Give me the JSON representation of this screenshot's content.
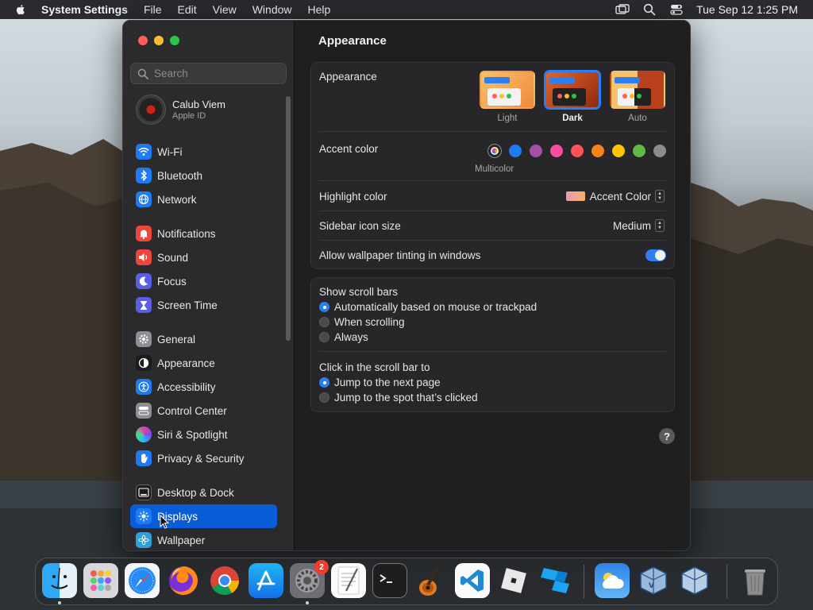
{
  "menubar": {
    "app_name": "System Settings",
    "menus": [
      "File",
      "Edit",
      "View",
      "Window",
      "Help"
    ],
    "clock": "Tue Sep 12  1:25 PM"
  },
  "sidebar": {
    "search_placeholder": "Search",
    "account": {
      "name": "Calub Viem",
      "subtitle": "Apple ID"
    },
    "items": [
      {
        "label": "Wi-Fi",
        "icon": "wifi-icon",
        "color": "#1e7bf2"
      },
      {
        "label": "Bluetooth",
        "icon": "bluetooth-icon",
        "color": "#1e7bf2"
      },
      {
        "label": "Network",
        "icon": "globe-icon",
        "color": "#1e7bf2"
      },
      {
        "label": "Notifications",
        "icon": "bell-icon",
        "color": "#f0453a"
      },
      {
        "label": "Sound",
        "icon": "speaker-icon",
        "color": "#f0453a"
      },
      {
        "label": "Focus",
        "icon": "moon-icon",
        "color": "#5b5ee0"
      },
      {
        "label": "Screen Time",
        "icon": "hourglass-icon",
        "color": "#5b5ee0"
      },
      {
        "label": "General",
        "icon": "gear-icon",
        "color": "#8e8e93"
      },
      {
        "label": "Appearance",
        "icon": "appearance-icon",
        "color": "#1c1c1e"
      },
      {
        "label": "Accessibility",
        "icon": "accessibility-icon",
        "color": "#1e7bf2"
      },
      {
        "label": "Control Center",
        "icon": "control-center-icon",
        "color": "#8e8e93"
      },
      {
        "label": "Siri & Spotlight",
        "icon": "siri-icon",
        "color": "#b53ac8"
      },
      {
        "label": "Privacy & Security",
        "icon": "hand-icon",
        "color": "#1e7bf2"
      },
      {
        "label": "Desktop & Dock",
        "icon": "dock-icon",
        "color": "#1c1c1e"
      },
      {
        "label": "Displays",
        "icon": "sun-icon",
        "color": "#1e7bf2"
      },
      {
        "label": "Wallpaper",
        "icon": "flower-icon",
        "color": "#2fa0d8"
      }
    ]
  },
  "main": {
    "title": "Appearance",
    "appearance": {
      "label": "Appearance",
      "options": [
        "Light",
        "Dark",
        "Auto"
      ],
      "selected": "Dark"
    },
    "accent": {
      "label": "Accent color",
      "multicolor_label": "Multicolor",
      "colors": [
        "#1e7bf2",
        "#a550a7",
        "#f74f9e",
        "#ff5257",
        "#f7821b",
        "#ffc600",
        "#62ba46",
        "#8c8c8c"
      ]
    },
    "highlight": {
      "label": "Highlight color",
      "value": "Accent Color"
    },
    "sidebar_icon_size": {
      "label": "Sidebar icon size",
      "value": "Medium"
    },
    "wallpaper_tinting": {
      "label": "Allow wallpaper tinting in windows",
      "enabled": true
    },
    "scroll_bars": {
      "label": "Show scroll bars",
      "options": [
        "Automatically based on mouse or trackpad",
        "When scrolling",
        "Always"
      ],
      "selected_index": 0
    },
    "click_scroll": {
      "label": "Click in the scroll bar to",
      "options": [
        "Jump to the next page",
        "Jump to the spot that’s clicked"
      ],
      "selected_index": 0
    },
    "help_label": "?"
  },
  "dock": {
    "settings_badge": "2",
    "apps": [
      "finder-icon",
      "launchpad-icon",
      "safari-icon",
      "firefox-icon",
      "chrome-icon",
      "app-store-icon",
      "system-settings-icon",
      "textedit-icon",
      "terminal-icon",
      "garageband-icon",
      "vscode-icon",
      "roblox-icon",
      "roblox-studio-icon",
      "weather-icon",
      "virtualbox-icon",
      "virtualbox-vm-icon",
      "trash-icon"
    ]
  }
}
